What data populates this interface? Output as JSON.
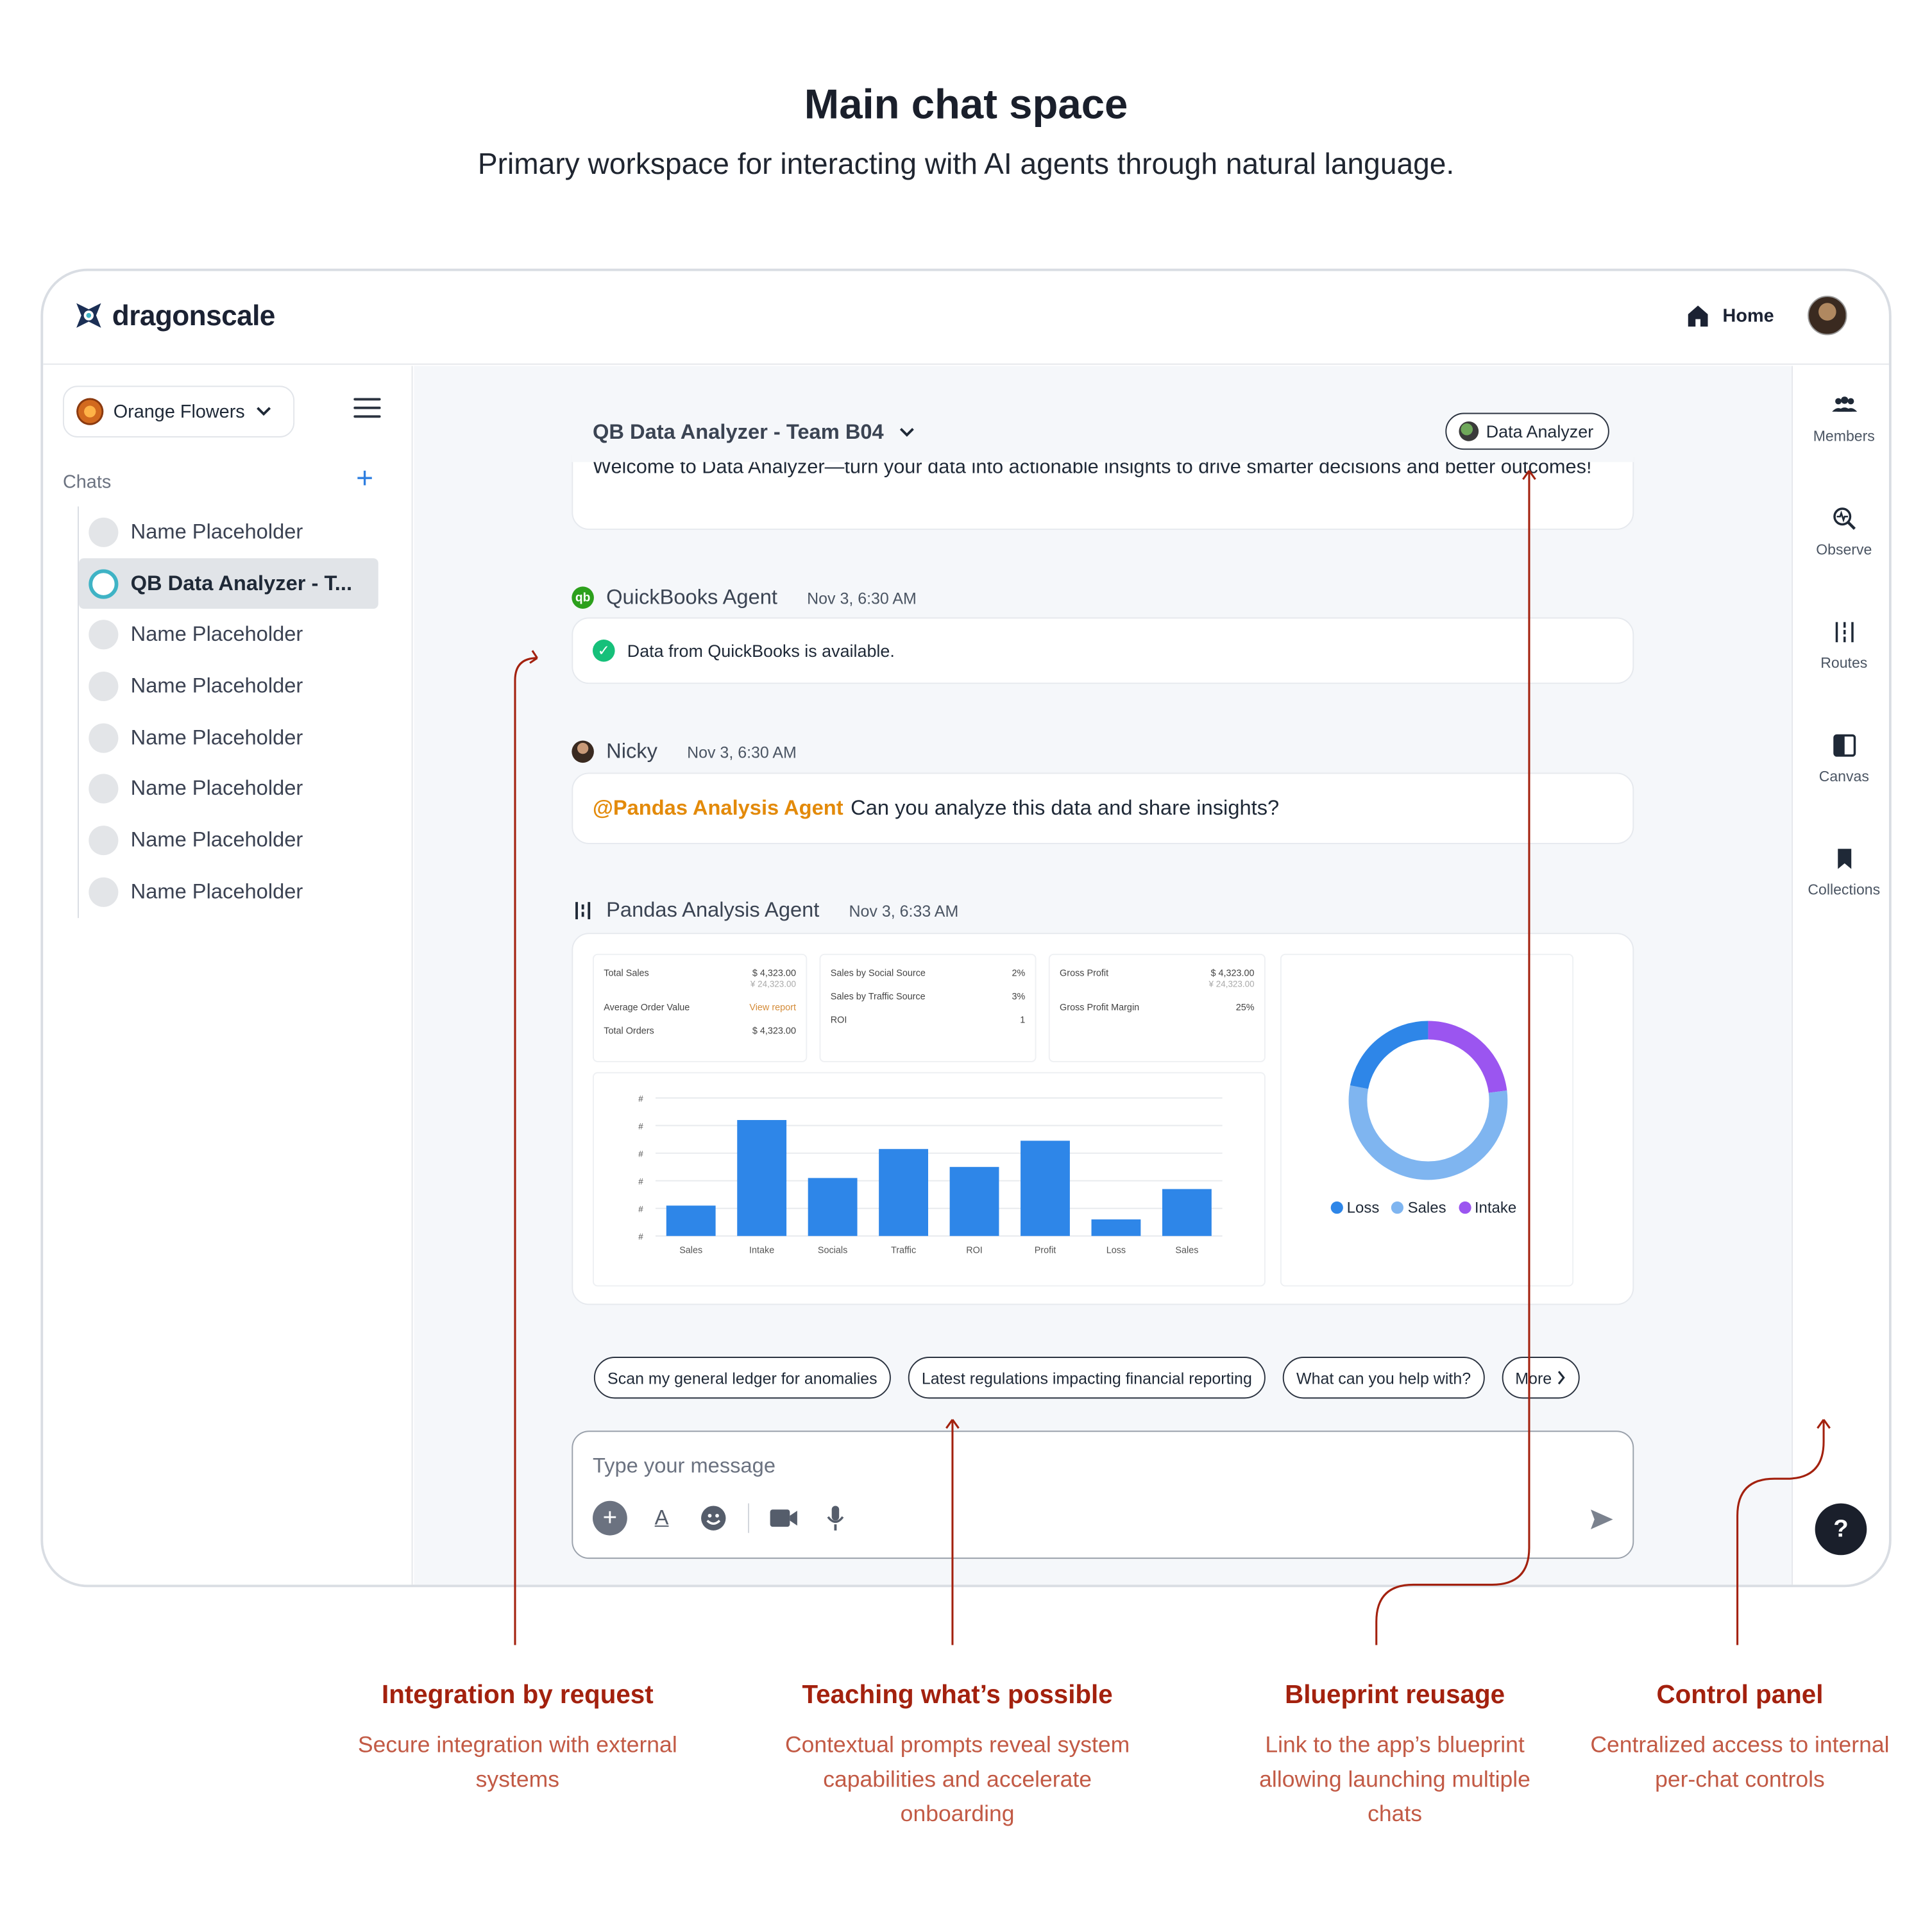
{
  "hero": {
    "title": "Main chat space",
    "subtitle": "Primary workspace for interacting with AI agents through natural language."
  },
  "app": {
    "brand": "dragonscale",
    "nav_home": "Home"
  },
  "sidebar": {
    "workspace": "Orange Flowers",
    "chats_label": "Chats",
    "chats": [
      {
        "label": "Name Placeholder"
      },
      {
        "label": "QB Data Analyzer - T...",
        "active": true
      },
      {
        "label": "Name Placeholder"
      },
      {
        "label": "Name Placeholder"
      },
      {
        "label": "Name Placeholder"
      },
      {
        "label": "Name Placeholder"
      },
      {
        "label": "Name Placeholder"
      },
      {
        "label": "Name Placeholder"
      }
    ]
  },
  "rail": {
    "items": [
      {
        "label": "Members",
        "icon": "members-icon"
      },
      {
        "label": "Observe",
        "icon": "observe-icon"
      },
      {
        "label": "Routes",
        "icon": "routes-icon"
      },
      {
        "label": "Canvas",
        "icon": "canvas-icon"
      },
      {
        "label": "Collections",
        "icon": "bookmark-icon"
      }
    ],
    "help": "?"
  },
  "conversation": {
    "title": "QB Data Analyzer - Team B04",
    "agent_pill": "Data Analyzer",
    "welcome": "Welcome to Data Analyzer—turn your data into actionable insights to drive smarter decisions and better outcomes!",
    "messages": [
      {
        "author": "QuickBooks Agent",
        "time": "Nov 3, 6:30 AM",
        "text": "Data from QuickBooks is available."
      },
      {
        "author": "Nicky",
        "time": "Nov 3, 6:30 AM",
        "mention": "@Pandas Analysis Agent",
        "text": "Can you analyze this data and share insights?"
      },
      {
        "author": "Pandas Analysis Agent",
        "time": "Nov 3, 6:33 AM"
      }
    ],
    "kpis": {
      "card1": {
        "total_sales_label": "Total Sales",
        "total_sales_value": "$ 4,323.00",
        "total_sales_sub": "¥ 24,323.00",
        "aov_label": "Average Order Value",
        "aov_value": "View report",
        "orders_label": "Total Orders",
        "orders_value": "$ 4,323.00"
      },
      "card2": {
        "social_label": "Sales by Social Source",
        "social_value": "2%",
        "traffic_label": "Sales by Traffic Source",
        "traffic_value": "3%",
        "roi_label": "ROI",
        "roi_value": "1"
      },
      "card3": {
        "gp_label": "Gross Profit",
        "gp_value": "$ 4,323.00",
        "gp_sub": "¥ 24,323.00",
        "gpm_label": "Gross Profit Margin",
        "gpm_value": "25%"
      }
    },
    "suggestions": [
      "Scan my general ledger for anomalies",
      "Latest regulations impacting financial reporting",
      "What can you help with?",
      "More"
    ],
    "composer_placeholder": "Type your message"
  },
  "chart_data": [
    {
      "type": "bar",
      "categories": [
        "Sales",
        "Intake",
        "Socials",
        "Traffic",
        "ROI",
        "Profit",
        "Loss",
        "Sales"
      ],
      "values": [
        22,
        84,
        42,
        63,
        50,
        69,
        12,
        34
      ],
      "ytick_labels": [
        "#",
        "#",
        "#",
        "#",
        "#",
        "#"
      ],
      "ylim": [
        0,
        100
      ],
      "color": "#2e86e8",
      "grid": true
    },
    {
      "type": "pie",
      "variant": "donut",
      "series": [
        {
          "name": "Loss",
          "value": 22,
          "color": "#2e86e8"
        },
        {
          "name": "Sales",
          "value": 55,
          "color": "#7fb5f0"
        },
        {
          "name": "Intake",
          "value": 23,
          "color": "#9b55f0"
        }
      ],
      "legend": "bottom"
    }
  ],
  "annotations": [
    {
      "title": "Integration by request",
      "desc": "Secure integration with external systems"
    },
    {
      "title": "Teaching what’s possible",
      "desc": "Contextual prompts reveal system capabilities and accelerate onboarding"
    },
    {
      "title": "Blueprint reusage",
      "desc": "Link to the app’s blueprint allowing launching multiple chats"
    },
    {
      "title": "Control panel",
      "desc": "Centralized access to internal per-chat controls"
    }
  ],
  "colors": {
    "accent": "#2e86e8",
    "annotation_title": "#a3210e",
    "annotation_text": "#c25a45",
    "mention": "#e38a0a",
    "success": "#16c07a"
  }
}
